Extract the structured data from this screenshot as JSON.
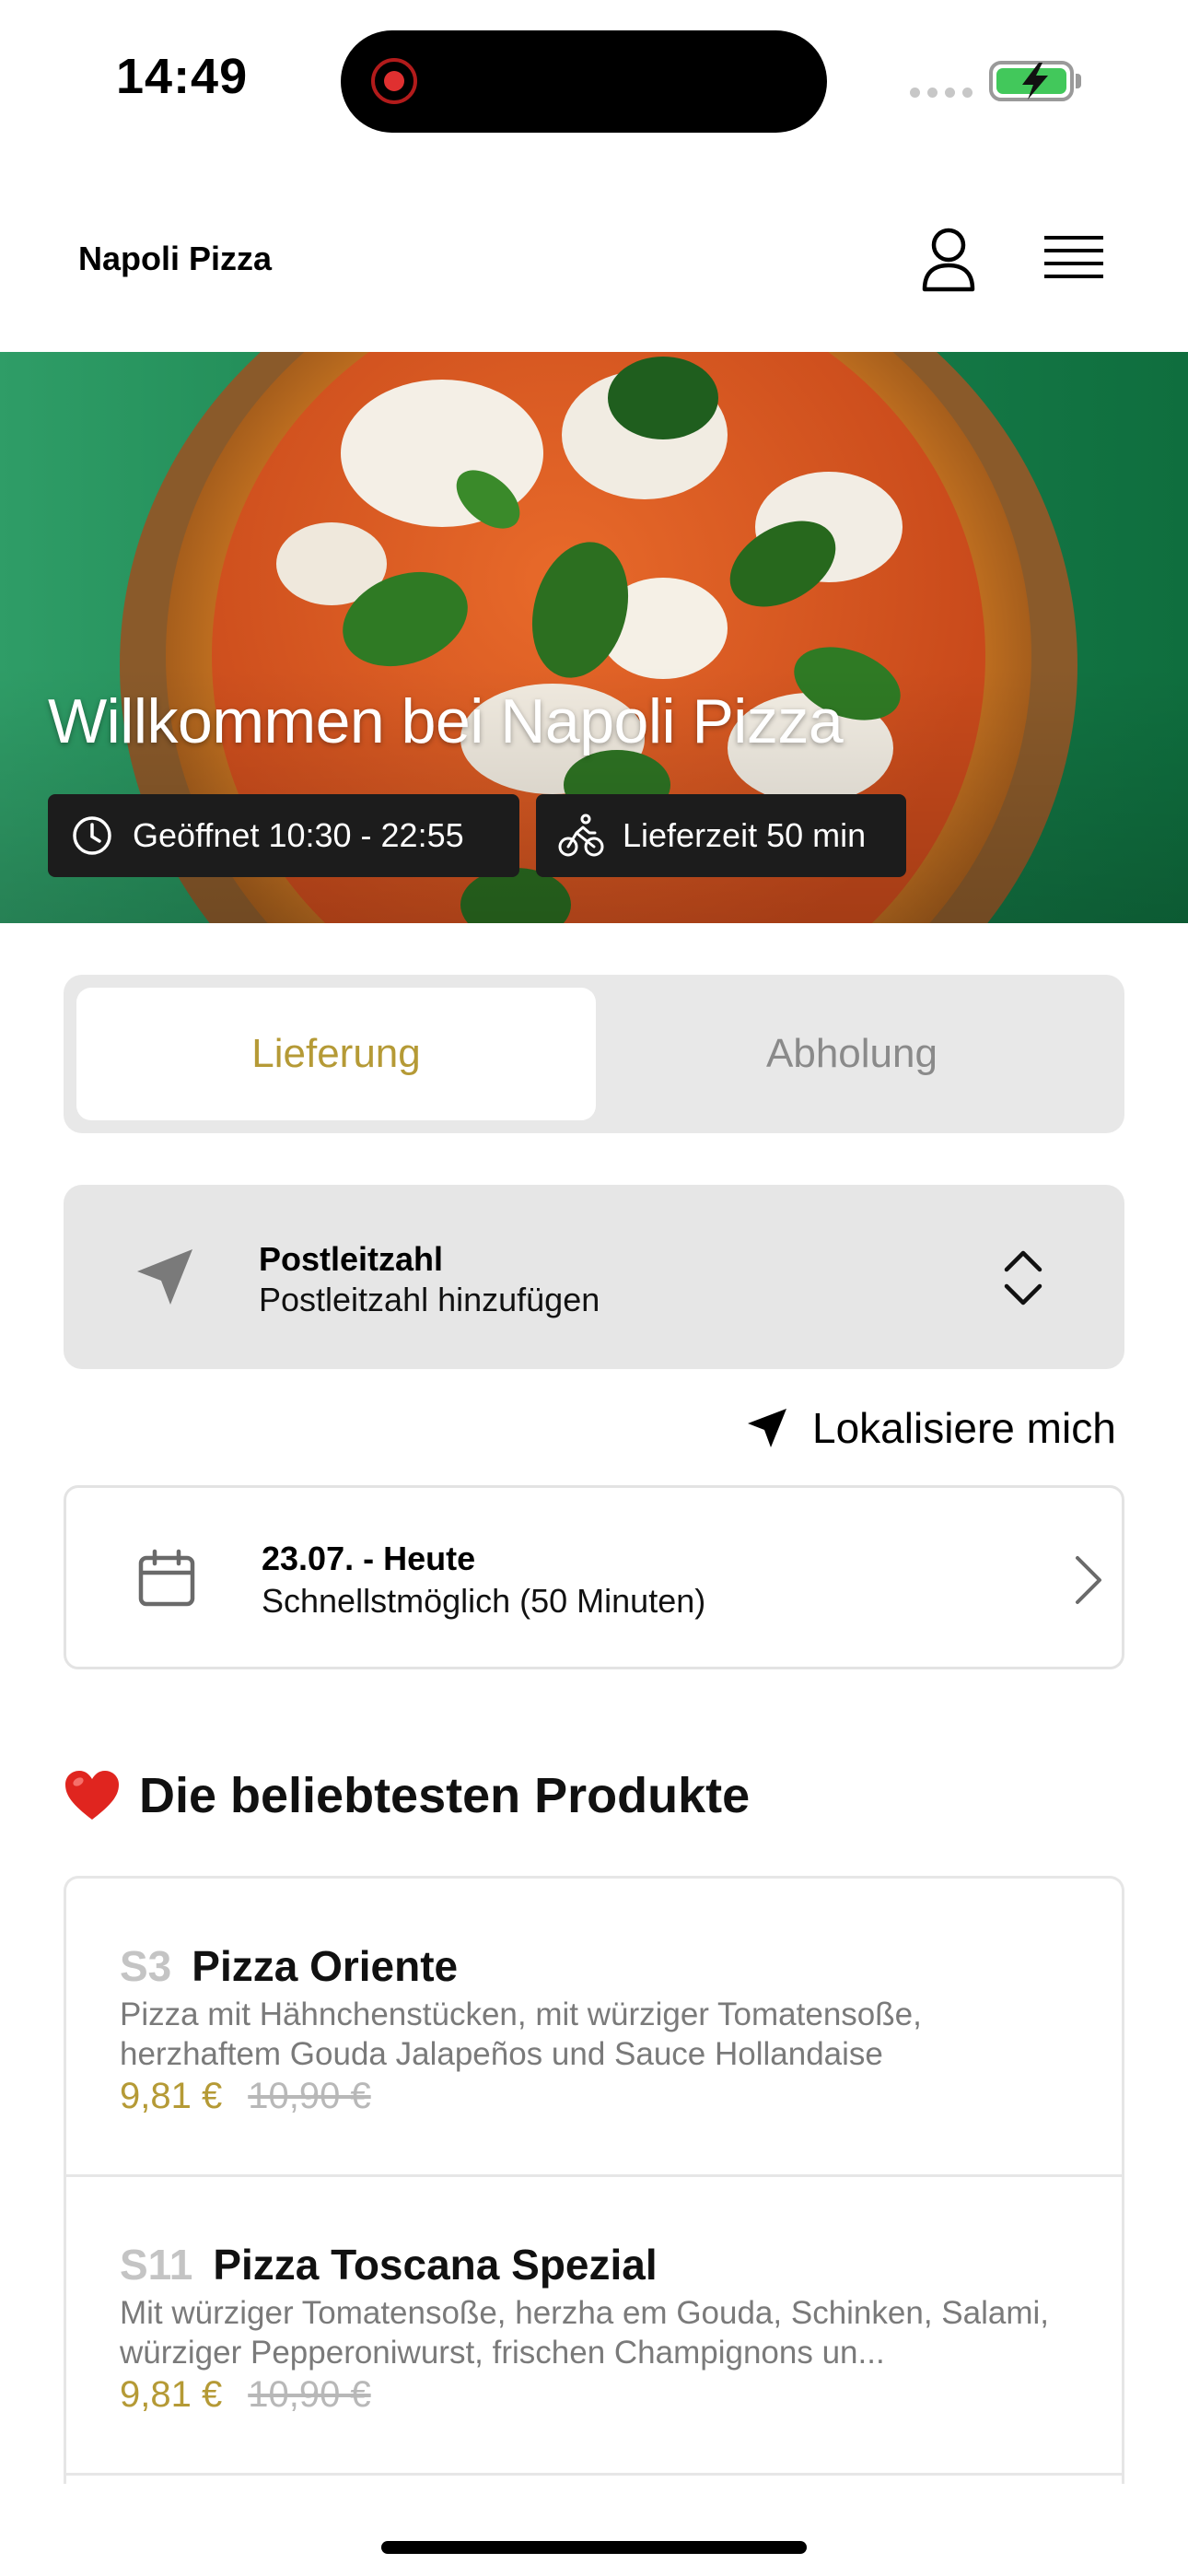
{
  "status_bar": {
    "time": "14:49"
  },
  "header": {
    "brand": "Napoli Pizza",
    "icons": [
      "user-icon",
      "menu-icon"
    ]
  },
  "hero": {
    "title": "Willkommen bei Napoli Pizza",
    "opening_hours": "Geöffnet 10:30 - 22:55",
    "delivery_time": "Lieferzeit 50 min",
    "colors": {
      "background": "#1f8a55",
      "chip": "#1c1c1c"
    }
  },
  "order_mode": {
    "tabs": [
      {
        "label": "Lieferung",
        "selected": true
      },
      {
        "label": "Abholung",
        "selected": false
      }
    ],
    "accent_color": "#b59a36"
  },
  "postcode": {
    "label": "Postleitzahl",
    "value": "Postleitzahl hinzufügen"
  },
  "locate": {
    "label": "Lokalisiere mich"
  },
  "schedule": {
    "date": "23.07. - Heute",
    "time": "Schnellstmöglich (50 Minuten)"
  },
  "popular": {
    "title": "Die beliebtesten Produkte",
    "products": [
      {
        "code": "S3",
        "name": "Pizza Oriente",
        "description": "Pizza mit Hähnchenstücken, mit würziger Tomatensoße, herzhaftem Gouda Jalapeños und Sauce Hollandaise",
        "price": "9,81 €",
        "old_price": "10,90 €"
      },
      {
        "code": "S11",
        "name": "Pizza Toscana Spezial",
        "description": "Mit würziger Tomatensoße, herzha em Gouda, Schinken, Salami, würziger Pepperoniwurst, frischen Champignons un...",
        "price": "9,81 €",
        "old_price": "10,90 €"
      }
    ]
  }
}
